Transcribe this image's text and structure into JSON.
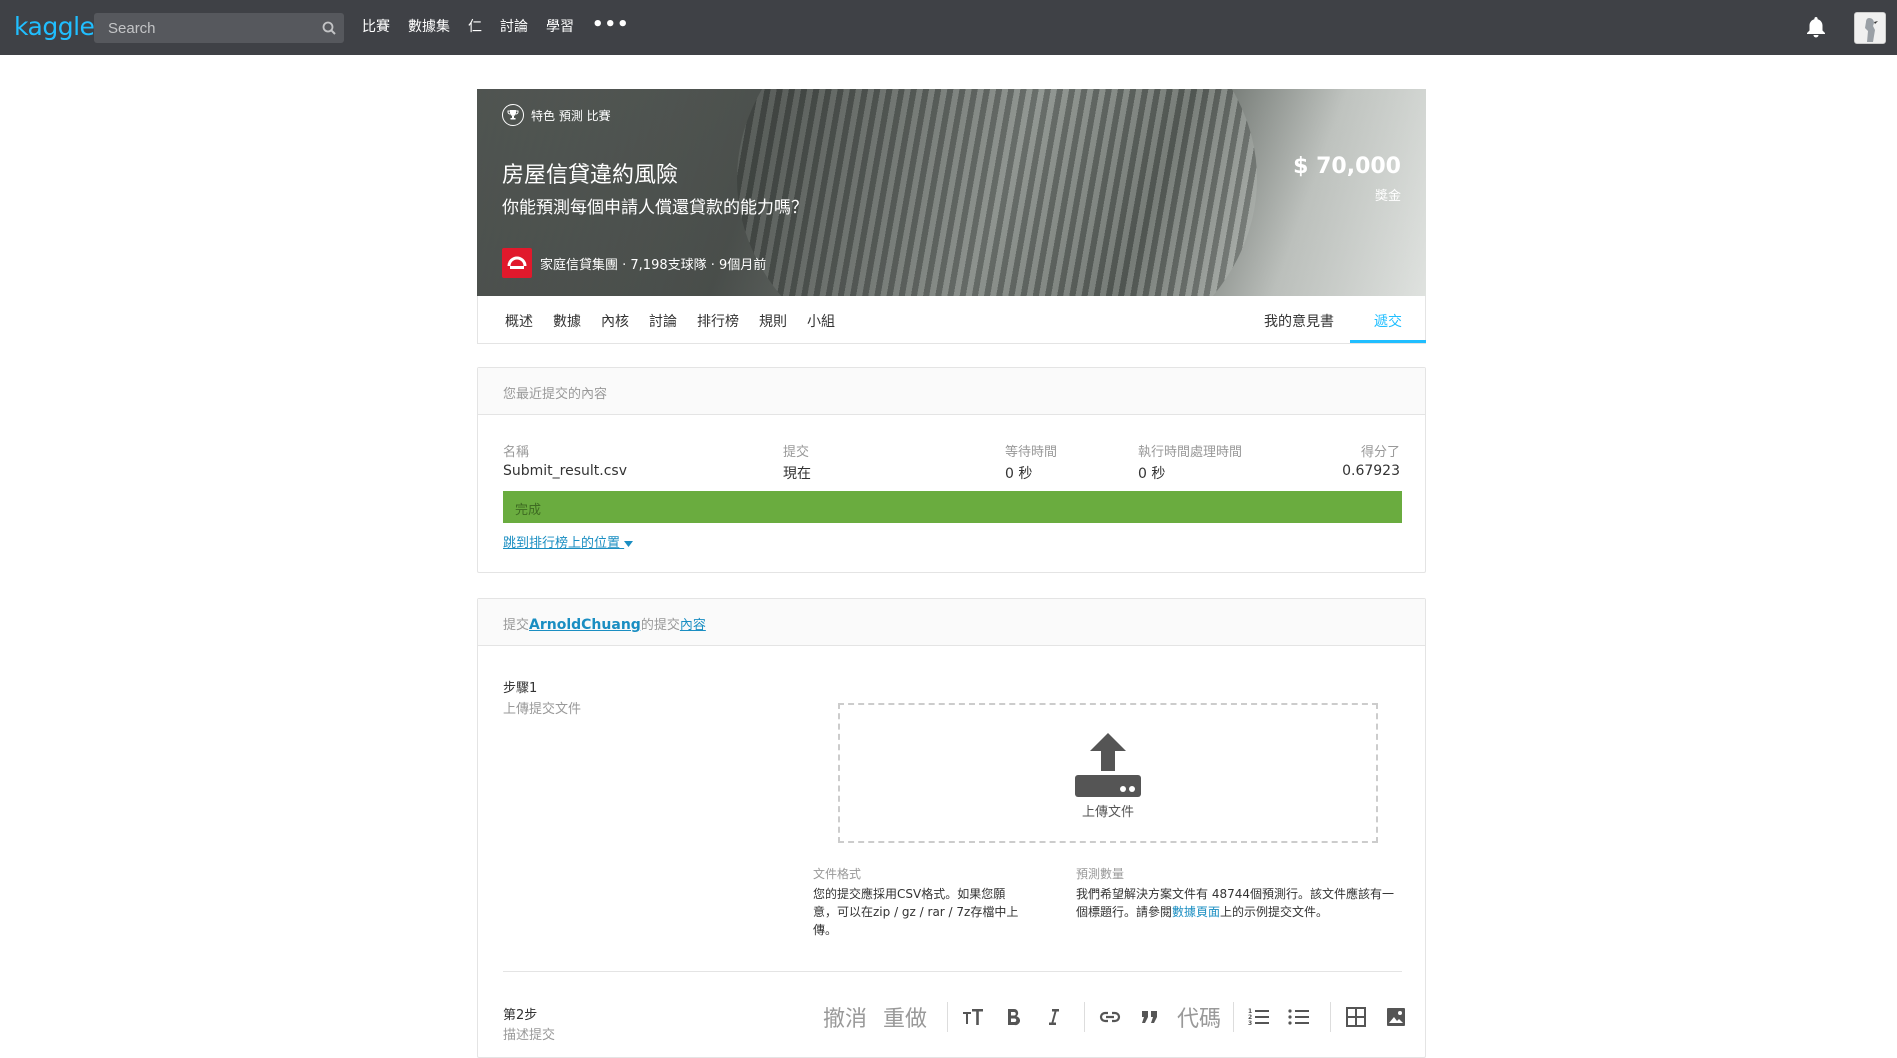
{
  "nav": {
    "logo": "kaggle",
    "search_placeholder": "Search",
    "links": [
      "比賽",
      "數據集",
      "仁",
      "討論",
      "學習"
    ],
    "more": "•••"
  },
  "banner": {
    "badge": "特色 預測 比賽",
    "title": "房屋信貸違約風險",
    "subtitle": "你能預測每個申請人償還貸款的能力嗎？",
    "prize_amount": "$ 70,000",
    "prize_label": "獎金",
    "host_meta": "家庭信貸集團 · 7,198支球隊 · 9個月前"
  },
  "tabs": {
    "items": [
      "概述",
      "數據",
      "內核",
      "討論",
      "排行榜",
      "規則",
      "小組"
    ],
    "feedback": "我的意見書",
    "submit": "遞交"
  },
  "recent": {
    "header": "您最近提交的內容",
    "columns": [
      {
        "label": "名稱",
        "value": "Submit_result.csv"
      },
      {
        "label": "提交",
        "value": "現在"
      },
      {
        "label": "等待時間",
        "value": "0 秒"
      },
      {
        "label": "執行時間處理時間",
        "value": "0 秒"
      },
      {
        "label": "得分了",
        "value": "0.67923"
      }
    ],
    "status": "完成",
    "leaderboard_link": "跳到排行榜上的位置"
  },
  "submit_panel": {
    "head_prefix": "提交",
    "head_user": "ArnoldChuang",
    "head_mid": "的提交",
    "head_link": "內容",
    "step1_label": "步驟1",
    "step1_desc": "上傳提交文件",
    "upload_text": "上傳文件",
    "format_title": "文件格式",
    "format_body": "您的提交應採用CSV格式。如果您願意，可以在zip / gz / rar / 7z存檔中上傳。",
    "pred_title": "預測數量",
    "pred_body_1": "我們希望解決方案文件有 48744個預測行。該文件應該有一個標題行。請參閱",
    "pred_link": "數據頁面",
    "pred_body_2": "上的示例提交文件。",
    "step2_label": "第2步",
    "step2_desc": "描述提交",
    "toolbar": {
      "undo": "撤消",
      "redo": "重做",
      "code": "代碼"
    }
  }
}
